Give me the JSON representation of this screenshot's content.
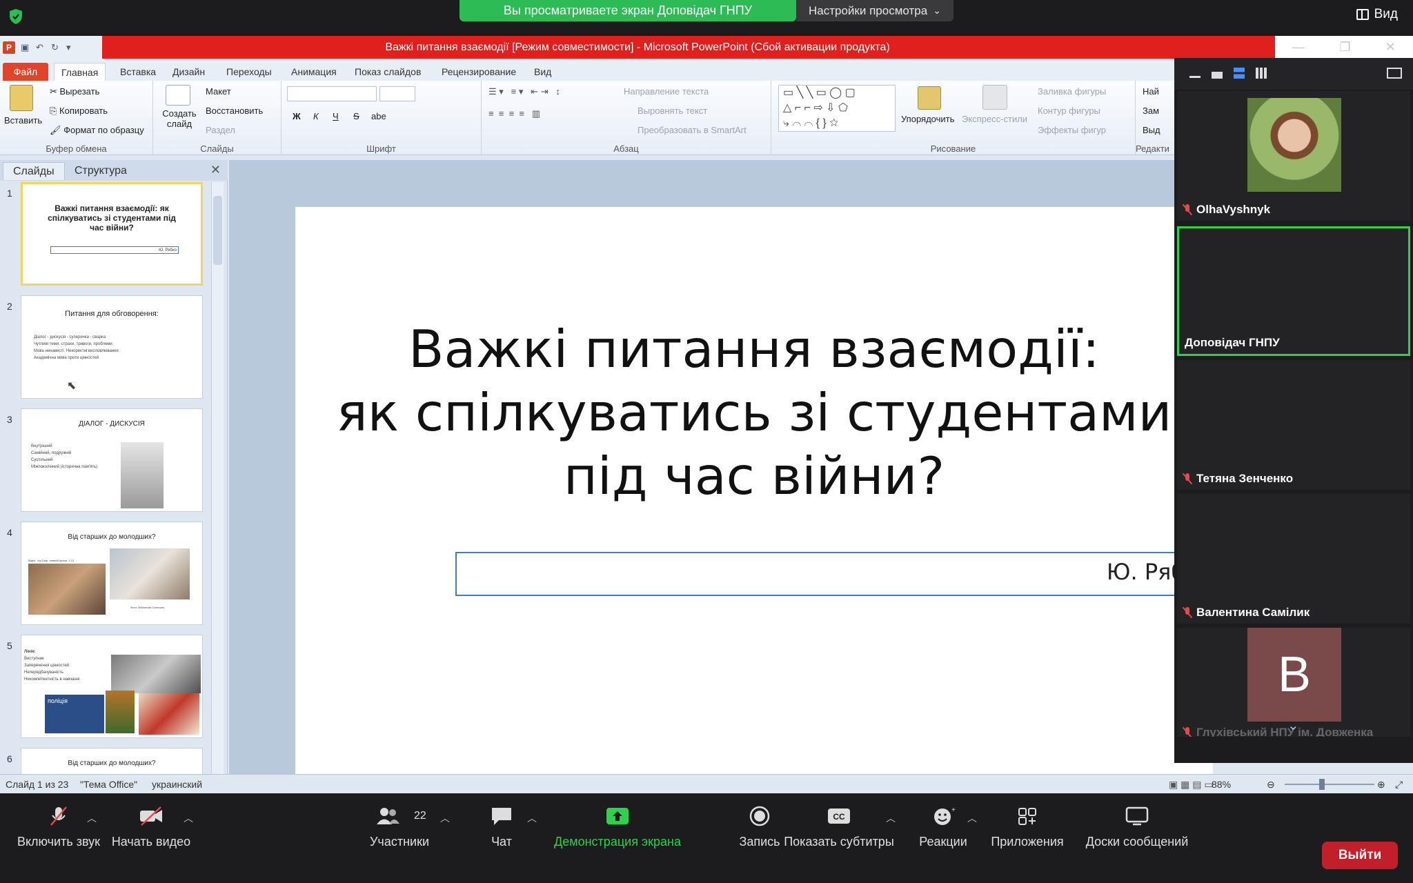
{
  "zoom_top": {
    "share_banner": "Вы просматриваете экран Доповідач ГНПУ",
    "view_settings": "Настройки просмотра",
    "view_button": "Вид"
  },
  "ppt": {
    "title": "Важкі питання взаємодії [Режим совместимости] - Microsoft PowerPoint (Сбой активации продукта)",
    "tabs": [
      "Файл",
      "Главная",
      "Вставка",
      "Дизайн",
      "Переходы",
      "Анимация",
      "Показ слайдов",
      "Рецензирование",
      "Вид"
    ],
    "ribbon": {
      "clipboard": {
        "paste": "Вставить",
        "cut": "Вырезать",
        "copy": "Копировать",
        "format": "Формат по образцу",
        "label": "Буфер обмена"
      },
      "slides": {
        "create": "Создать слайд",
        "layout": "Макет",
        "restore": "Восстановить",
        "section": "Раздел",
        "label": "Слайды"
      },
      "font": {
        "label": "Шрифт",
        "bold": "Ж",
        "italic": "К",
        "underline": "Ч",
        "strike": "S",
        "shadow": "abe"
      },
      "paragraph": {
        "label": "Абзац",
        "text_dir": "Направление текста",
        "align_text": "Выровнять текст",
        "smartart": "Преобразовать в SmartArt"
      },
      "drawing": {
        "label": "Рисование",
        "arrange": "Упорядочить",
        "quick_styles": "Экспресс-стили",
        "fill": "Заливка фигуры",
        "outline": "Контур фигуры",
        "effects": "Эффекты фигур"
      },
      "editing": {
        "label": "Редакти",
        "find": "Най",
        "replace": "Зам",
        "select": "Выд"
      }
    },
    "pane_tabs": [
      "Слайды",
      "Структура"
    ],
    "thumbnails": [
      {
        "num": "1",
        "title": "Важкі питання взаємодії: як спілкуватись зі студентами під час війни?",
        "author": "Ю. Рябко"
      },
      {
        "num": "2",
        "title": "Питання для обговорення:",
        "bullets": [
          "Діалог - дискусія - суперечка - сварка",
          "Чутливі теми: страхи, тривоги, проблеми",
          "Мова ненависті. Некоректні висловлювання",
          "Академічна мова проти цінностей"
        ]
      },
      {
        "num": "3",
        "title": "ДІАЛОГ - ДИСКУСІЯ",
        "bullets": [
          "Внутрішній",
          "Самійний, подружній",
          "Суспільний",
          "Міжпоколінний (історична пам'ять)"
        ]
      },
      {
        "num": "4",
        "title": "Від старших до молодших?",
        "caption": "Відео: YouTube, повний фільм, 1:12",
        "caption2": "Фото: Wikimedia Commons"
      },
      {
        "num": "5",
        "title": "Лінія:",
        "bullets": [
          "Виступник",
          "Заперечення цінностей",
          "Непередбачуваність",
          "Некомпетентність в навчанні"
        ],
        "badge": "поліція"
      },
      {
        "num": "6",
        "title": "Від старших до молодших?"
      }
    ],
    "slide": {
      "title_lines": [
        "Важкі питання взаємодії:",
        "як спілкуватись зі студентами",
        "під час війни?"
      ],
      "subtitle": "Ю. Рябко"
    },
    "status": {
      "slide": "Слайд 1 из 23",
      "theme": "\"Тема Office\"",
      "lang": "украинский",
      "zoom": "88%"
    }
  },
  "participants": [
    {
      "name": "OlhaVyshnyk",
      "muted": true,
      "type": "photo"
    },
    {
      "name": "Доповідач ГНПУ",
      "muted": false,
      "type": "active"
    },
    {
      "name": "Тетяна Зенченко",
      "muted": true,
      "type": "blank"
    },
    {
      "name": "Валентина Самілик",
      "muted": true,
      "type": "blank"
    },
    {
      "name": "Глухівський НПУ ім. Довженка",
      "muted": true,
      "type": "letter",
      "letter": "В"
    }
  ],
  "toolbar": {
    "mute": "Включить звук",
    "video": "Начать видео",
    "participants": "Участники",
    "participants_count": "22",
    "chat": "Чат",
    "share": "Демонстрация экрана",
    "record": "Запись",
    "captions": "Показать субтитры",
    "reactions": "Реакции",
    "apps": "Приложения",
    "whiteboards": "Доски сообщений",
    "exit": "Выйти"
  },
  "colors": {
    "ppt_title_red": "#e01f1f",
    "share_green": "#2dbb55",
    "active_tile": "#2dd24a",
    "exit_red": "#c21f2a"
  }
}
